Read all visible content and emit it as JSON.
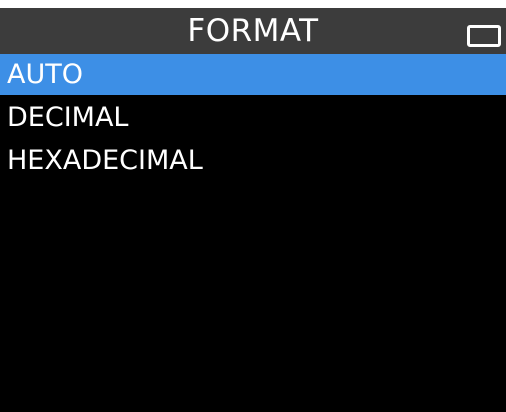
{
  "header": {
    "title": "FORMAT",
    "battery_icon": "battery-icon",
    "background_color": "#3c3c3c"
  },
  "menu": {
    "selected_index": 0,
    "selection_color": "#3d8fe6",
    "items": [
      {
        "label": "AUTO"
      },
      {
        "label": "DECIMAL"
      },
      {
        "label": "HEXADECIMAL"
      }
    ]
  }
}
